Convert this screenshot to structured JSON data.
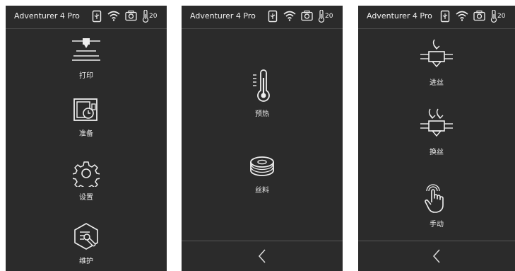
{
  "panels": [
    {
      "title": "Adventurer 4 Pro",
      "temperature": "20",
      "menu": [
        {
          "label": "打印",
          "icon": "print-icon"
        },
        {
          "label": "准备",
          "icon": "prepare-icon"
        },
        {
          "label": "设置",
          "icon": "gear-icon"
        },
        {
          "label": "维护",
          "icon": "maintenance-icon"
        }
      ]
    },
    {
      "title": "Adventurer 4 Pro",
      "temperature": "20",
      "menu": [
        {
          "label": "预热",
          "icon": "thermometer-icon"
        },
        {
          "label": "丝料",
          "icon": "filament-spool-icon"
        }
      ],
      "back_icon": "chevron-left-icon"
    },
    {
      "title": "Adventurer 4 Pro",
      "temperature": "20",
      "menu": [
        {
          "label": "进丝",
          "icon": "filament-load-icon"
        },
        {
          "label": "换丝",
          "icon": "filament-change-icon"
        },
        {
          "label": "手动",
          "icon": "hand-tap-icon"
        }
      ],
      "back_icon": "chevron-left-icon"
    }
  ],
  "colors": {
    "panel_bg": "#2b2b2b",
    "text": "#e8e8e8",
    "divider": "#4a4a4a"
  }
}
